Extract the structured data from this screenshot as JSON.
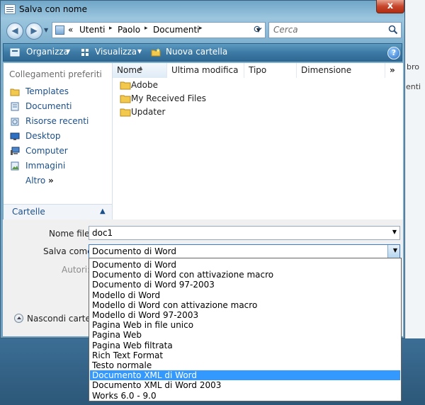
{
  "window": {
    "title": "Salva con nome",
    "close_glyph": "x"
  },
  "background": {
    "frag1": "bro",
    "frag2": "enti"
  },
  "address": {
    "overflow": "«",
    "crumbs": [
      "Utenti",
      "Paolo",
      "Documenti"
    ],
    "separator": "▸"
  },
  "search": {
    "placeholder": "Cerca"
  },
  "toolbar": {
    "organize": "Organizza",
    "views": "Visualizza",
    "new_folder": "Nuova cartella",
    "help": "?"
  },
  "sidebar": {
    "header": "Collegamenti preferiti",
    "items": [
      {
        "label": "Templates",
        "icon": "folder-icon"
      },
      {
        "label": "Documenti",
        "icon": "documents-icon"
      },
      {
        "label": "Risorse recenti",
        "icon": "recent-icon"
      },
      {
        "label": "Desktop",
        "icon": "desktop-icon"
      },
      {
        "label": "Computer",
        "icon": "computer-icon"
      },
      {
        "label": "Immagini",
        "icon": "pictures-icon"
      },
      {
        "label": "Altro",
        "icon": "double-chevron-icon",
        "suffix": "»"
      }
    ],
    "folders_label": "Cartelle"
  },
  "file_list": {
    "columns": [
      "Nome",
      "Ultima modifica",
      "Tipo",
      "Dimensione"
    ],
    "overflow": "»",
    "rows": [
      "Adobe",
      "My Received Files",
      "Updater"
    ]
  },
  "form": {
    "filename_label": "Nome file:",
    "filename_value": "doc1",
    "saveas_label": "Salva come:",
    "saveas_value": "Documento di Word",
    "authors_label": "Autori:",
    "hide_folders": "Nascondi cartelle"
  },
  "dropdown": {
    "selected_index": 11,
    "options": [
      "Documento di Word",
      "Documento di Word con attivazione macro",
      "Documento di Word 97-2003",
      "Modello di Word",
      "Modello di Word con attivazione macro",
      "Modello di Word 97-2003",
      "Pagina Web in file unico",
      "Pagina Web",
      "Pagina Web filtrata",
      "Rich Text Format",
      "Testo normale",
      "Documento XML di Word",
      "Documento XML di Word 2003",
      "Works 6.0 - 9.0"
    ]
  },
  "colors": {
    "accent": "#3399ff",
    "link": "#1b4f8a",
    "toolbar": "#3d7aa5",
    "folder": "#e8b83c"
  }
}
